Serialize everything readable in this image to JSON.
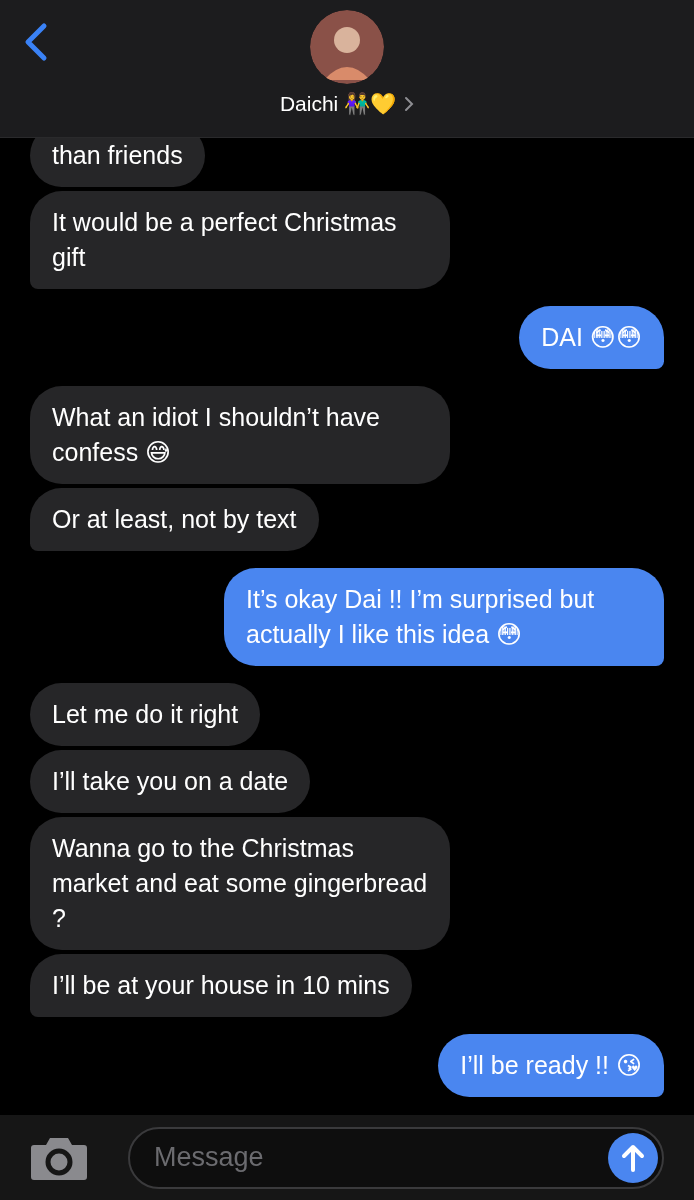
{
  "contact": {
    "name": "Daichi 👫💛"
  },
  "messages": [
    {
      "kind": "received",
      "text": "than friends"
    },
    {
      "kind": "received",
      "text": "It would be a perfect Christmas gift"
    },
    {
      "kind": "sent",
      "text": "DAI 😳😳"
    },
    {
      "kind": "received",
      "text": "What an idiot I shouldn’t have confess 😅"
    },
    {
      "kind": "received",
      "text": "Or at least, not by text"
    },
    {
      "kind": "sent",
      "text": "It’s okay Dai !! I’m surprised but actually I like this idea 😳"
    },
    {
      "kind": "received",
      "text": "Let me do it right"
    },
    {
      "kind": "received",
      "text": "I’ll take you on a date"
    },
    {
      "kind": "received",
      "text": "Wanna go to the Christmas market and eat some gingerbread ?"
    },
    {
      "kind": "received",
      "text": "I’ll be at your house in 10 mins"
    },
    {
      "kind": "sent",
      "text": "I’ll be ready !! 😘"
    }
  ],
  "composer": {
    "placeholder": "Message"
  }
}
